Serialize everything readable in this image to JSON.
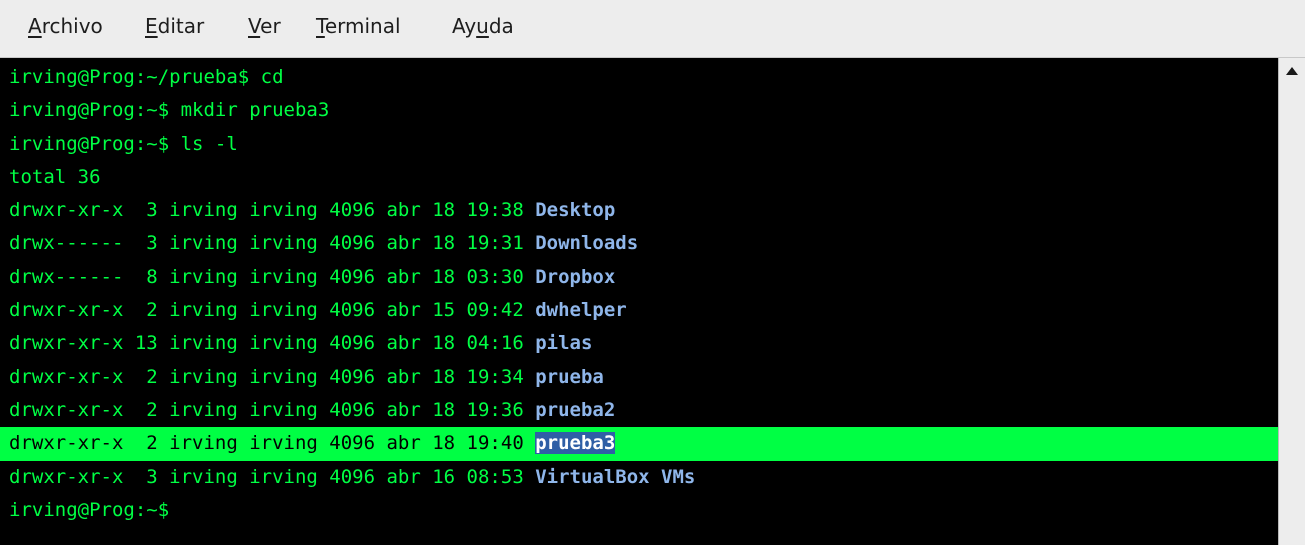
{
  "menu": {
    "items": [
      {
        "mnemonic": "A",
        "rest": "rchivo"
      },
      {
        "mnemonic": "E",
        "rest": "ditar"
      },
      {
        "mnemonic": "V",
        "rest": "er"
      },
      {
        "mnemonic": "T",
        "rest": "erminal"
      },
      {
        "pre": "Ay",
        "mnemonic": "u",
        "rest": "da"
      }
    ]
  },
  "terminal": {
    "lines": [
      {
        "text": "irving@Prog:~/prueba$ cd"
      },
      {
        "text": "irving@Prog:~$ mkdir prueba3"
      },
      {
        "text": "irving@Prog:~$ ls -l"
      },
      {
        "text": "total 36"
      },
      {
        "text": "drwxr-xr-x  3 irving irving 4096 abr 18 19:38 ",
        "dir": "Desktop"
      },
      {
        "text": "drwx------  3 irving irving 4096 abr 18 19:31 ",
        "dir": "Downloads"
      },
      {
        "text": "drwx------  8 irving irving 4096 abr 18 03:30 ",
        "dir": "Dropbox"
      },
      {
        "text": "drwxr-xr-x  2 irving irving 4096 abr 15 09:42 ",
        "dir": "dwhelper"
      },
      {
        "text": "drwxr-xr-x 13 irving irving 4096 abr 18 04:16 ",
        "dir": "pilas"
      },
      {
        "text": "drwxr-xr-x  2 irving irving 4096 abr 18 19:34 ",
        "dir": "prueba"
      },
      {
        "text": "drwxr-xr-x  2 irving irving 4096 abr 18 19:36 ",
        "dir": "prueba2"
      },
      {
        "text": "drwxr-xr-x  2 irving irving 4096 abr 18 19:40 ",
        "dir": "prueba3",
        "highlighted": true
      },
      {
        "text": "drwxr-xr-x  3 irving irving 4096 abr 16 08:53 ",
        "dir": "VirtualBox VMs"
      },
      {
        "text": "irving@Prog:~$"
      }
    ]
  },
  "colors": {
    "background": "#000000",
    "foreground": "#00ff44",
    "directory": "#8fb6ea",
    "selection_bg": "#2f5fa6"
  },
  "scrollbar": {
    "up_icon": "arrow-up-icon"
  }
}
